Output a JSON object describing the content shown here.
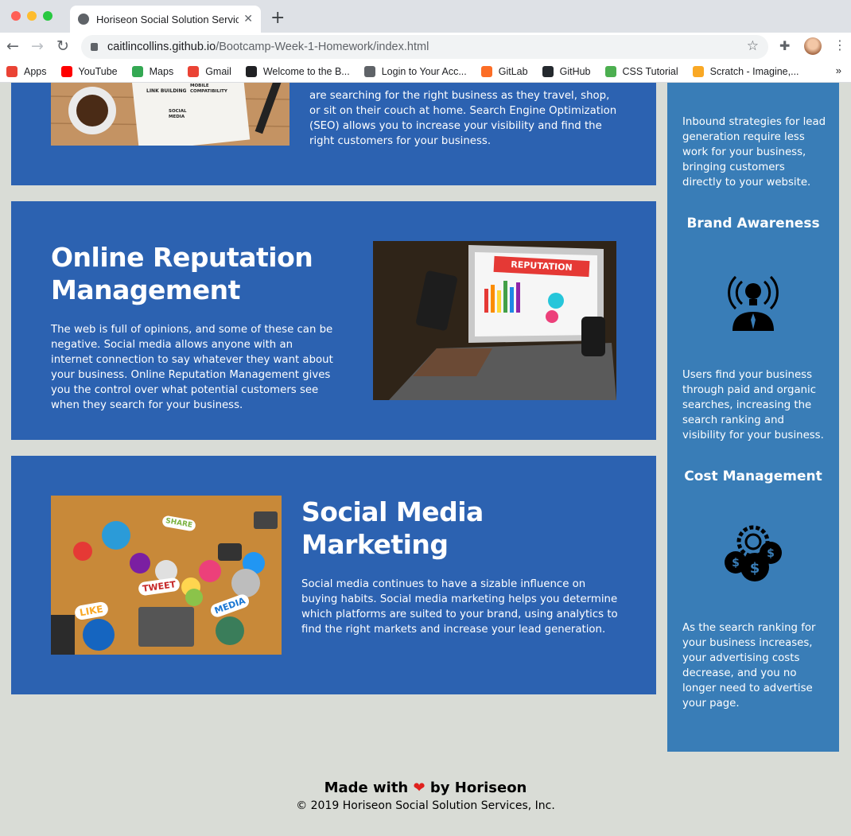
{
  "browser": {
    "tab_title": "Horiseon Social Solution Services",
    "url_host": "caitlincollins.github.io",
    "url_path": "/Bootcamp-Week-1-Homework/index.html",
    "bookmarks": [
      {
        "label": "Apps",
        "color": "#ea4335"
      },
      {
        "label": "YouTube",
        "color": "#ff0000"
      },
      {
        "label": "Maps",
        "color": "#34a853"
      },
      {
        "label": "Gmail",
        "color": "#ea4335"
      },
      {
        "label": "Welcome to the B...",
        "color": "#202124"
      },
      {
        "label": "Login to Your Acc...",
        "color": "#5f6368"
      },
      {
        "label": "GitLab",
        "color": "#fc6d26"
      },
      {
        "label": "GitHub",
        "color": "#24292e"
      },
      {
        "label": "CSS Tutorial",
        "color": "#4caf50"
      },
      {
        "label": "Scratch - Imagine,...",
        "color": "#f9a825"
      }
    ]
  },
  "sections": {
    "seo_text": "are searching for the right business as they travel, shop, or sit on their couch at home. Search Engine Optimization (SEO) allows you to increase your visibility and find the right customers for your business.",
    "seo_image_words": [
      "LINK BUILDING",
      "MOBILE COMPATIBILITY",
      "SOCIAL MEDIA"
    ],
    "reputation_title": "Online Reputation Management",
    "reputation_text": "The web is full of opinions, and some of these can be negative. Social media allows anyone with an internet connection to say whatever they want about your business. Online Reputation Management gives you the control over what potential customers see when they search for your business.",
    "reputation_image_label": "REPUTATION",
    "social_title": "Social Media Marketing",
    "social_text": "Social media continues to have a sizable influence on buying habits. Social media marketing helps you determine which platforms are suited to your brand, using analytics to find the right markets and increase your lead generation.",
    "social_image_words": [
      "SHARE",
      "TWEET",
      "LIKE",
      "MEDIA"
    ]
  },
  "aside": {
    "lead_text": "Inbound strategies for lead generation require less work for your business, bringing customers directly to your website.",
    "brand_title": "Brand Awareness",
    "brand_text": "Users find your business through paid and organic searches, increasing the search ranking and visibility for your business.",
    "cost_title": "Cost Management",
    "cost_text": "As the search ranking for your business increases, your advertising costs decrease, and you no longer need to advertise your page."
  },
  "footer": {
    "made_prefix": "Made with",
    "made_suffix": "by Horiseon",
    "copyright": "© 2019 Horiseon Social Solution Services, Inc."
  }
}
